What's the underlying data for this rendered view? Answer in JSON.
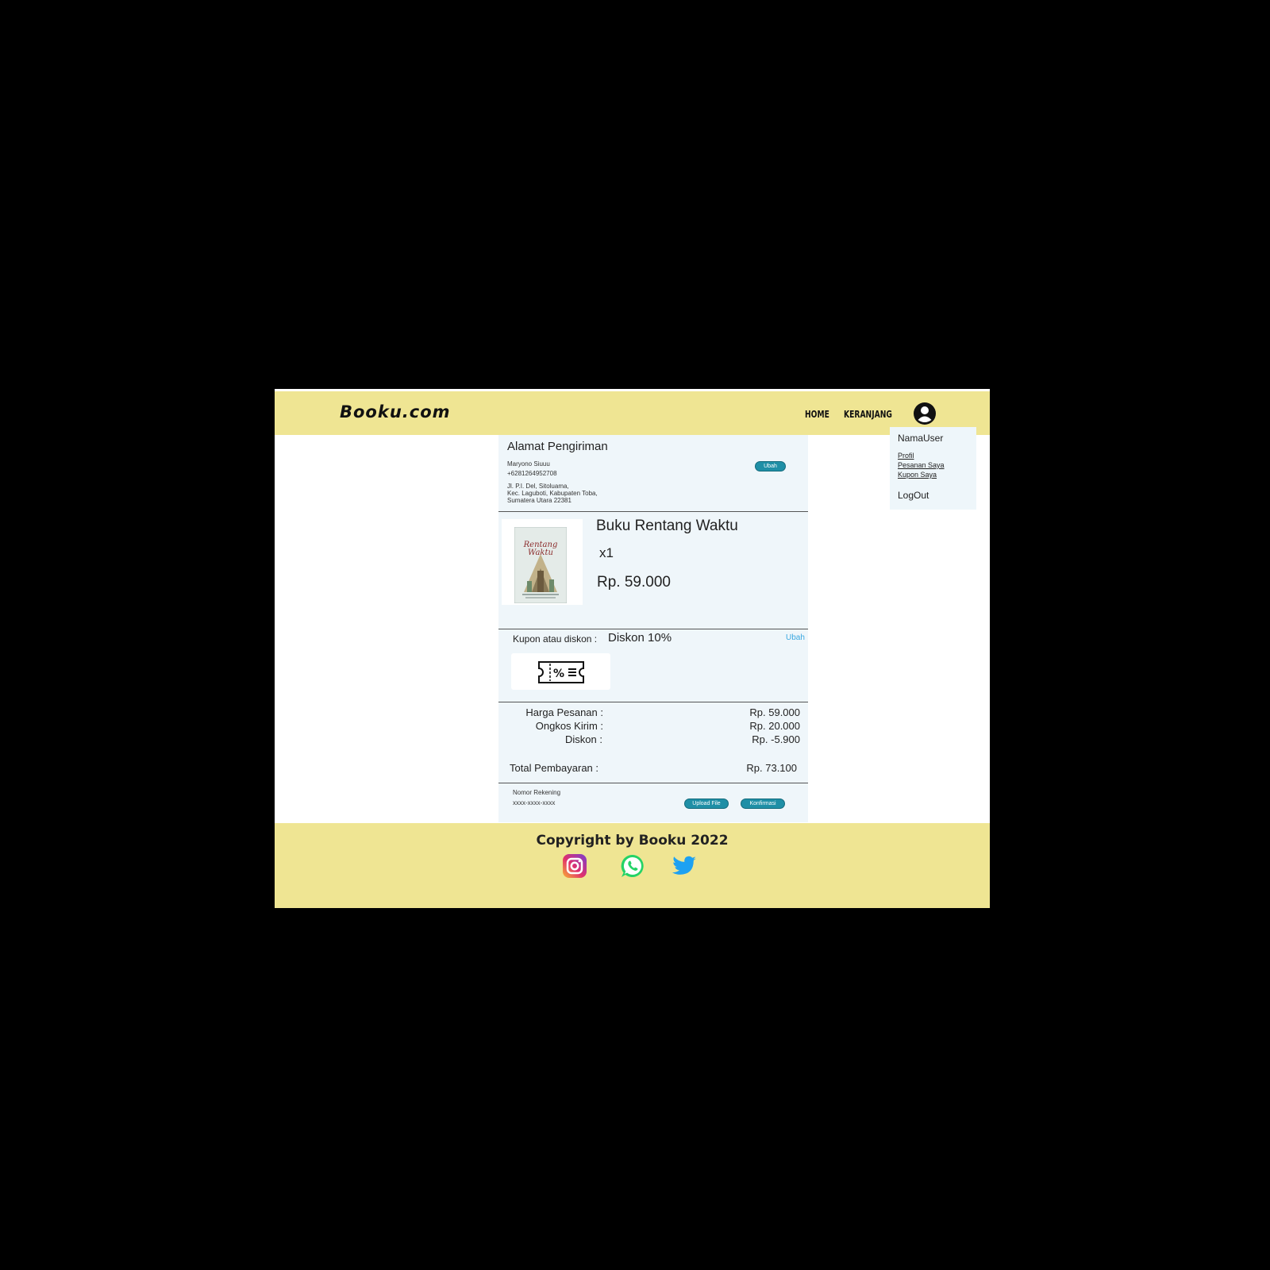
{
  "header": {
    "logo": "Booku.com",
    "nav": {
      "home": "HOME",
      "cart": "KERANJANG"
    }
  },
  "user_menu": {
    "name": "NamaUser",
    "profile": "Profil",
    "orders": "Pesanan Saya",
    "coupons": "Kupon Saya",
    "logout": "LogOut"
  },
  "address": {
    "title": "Alamat Pengiriman",
    "name": "Maryono Siuuu",
    "phone": "+6281264952708",
    "line1": "Jl. P.I. Del, Sitoluama,",
    "line2": "Kec. Laguboti, Kabupaten Toba,",
    "line3": "Sumatera Utara 22381",
    "edit_label": "Ubah"
  },
  "product": {
    "cover_title": "Rentang Waktu",
    "title": "Buku Rentang Waktu",
    "quantity": "x1",
    "price": "Rp. 59.000"
  },
  "coupon": {
    "label": "Kupon atau diskon :",
    "value": "Diskon 10%",
    "edit_label": "Ubah"
  },
  "summary": {
    "order_price_label": "Harga Pesanan :",
    "order_price": "Rp. 59.000",
    "shipping_label": "Ongkos Kirim :",
    "shipping": "Rp. 20.000",
    "discount_label": "Diskon :",
    "discount": "Rp. -5.900",
    "total_label": "Total Pembayaran :",
    "total": "Rp. 73.100"
  },
  "payment": {
    "account_label": "Nomor Rekening",
    "account_number": "xxxx-xxxx-xxxx",
    "upload_label": "Upload File",
    "confirm_label": "Konfirmasi"
  },
  "footer": {
    "copyright": "Copyright by Booku 2022"
  },
  "colors": {
    "header_bg": "#efe593",
    "panel_bg": "#eff6fa",
    "button": "#1f8fa6",
    "link": "#3aa8e0"
  }
}
